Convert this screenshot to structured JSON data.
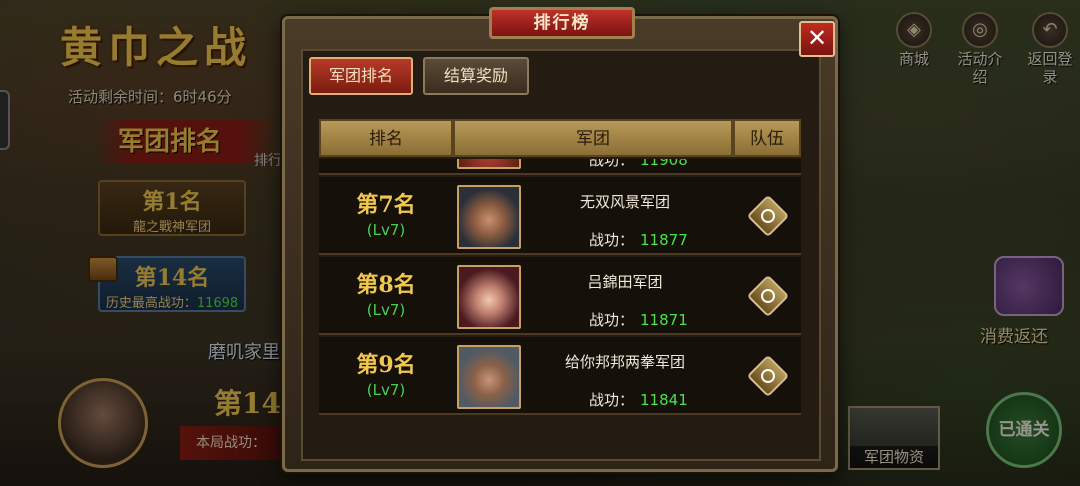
{
  "background": {
    "event_title": "黄巾之战",
    "timer_label": "活动剩余时间：",
    "timer_value": "6时46分",
    "rank_header": "军团排名",
    "rank_sub": "排行",
    "first_place": {
      "rank": "第1名",
      "name": "龍之戰神军团"
    },
    "my_legion": {
      "rank": "第14名",
      "power_label": "历史最高战功：",
      "power_value": "11698"
    },
    "mid_label": "磨叽家里",
    "my_rank_big": "第14",
    "round_power_label": "本局战功："
  },
  "top_icons": {
    "shop": {
      "label": "商城",
      "icon": "shop-icon"
    },
    "intro": {
      "label": "活动介绍",
      "icon": "info-icon"
    },
    "back": {
      "label": "返回登录",
      "icon": "return-arrow-icon"
    }
  },
  "side": {
    "consume_label": "消费返还",
    "cleared_label": "已通关",
    "supplies_label": "军团物资"
  },
  "modal": {
    "title": "排行榜",
    "close_icon": "close-icon",
    "tabs": [
      "军团排名",
      "结算奖励"
    ],
    "active_tab": "军团排名",
    "columns": [
      "排名",
      "军团",
      "队伍"
    ],
    "partial_row": {
      "power_label": "战功：",
      "power_value": "11908"
    },
    "rows": [
      {
        "rank": "第7名",
        "level": "(Lv7)",
        "name": "无双风景军团",
        "power_label": "战功：",
        "power_value": "11877"
      },
      {
        "rank": "第8名",
        "level": "(Lv7)",
        "name": "吕錦田军团",
        "power_label": "战功：",
        "power_value": "11871"
      },
      {
        "rank": "第9名",
        "level": "(Lv7)",
        "name": "给你邦邦两拳军团",
        "power_label": "战功：",
        "power_value": "11841"
      }
    ]
  },
  "colors": {
    "gold": "#f0c850",
    "green": "#4ce04c",
    "red": "#b83a28"
  }
}
